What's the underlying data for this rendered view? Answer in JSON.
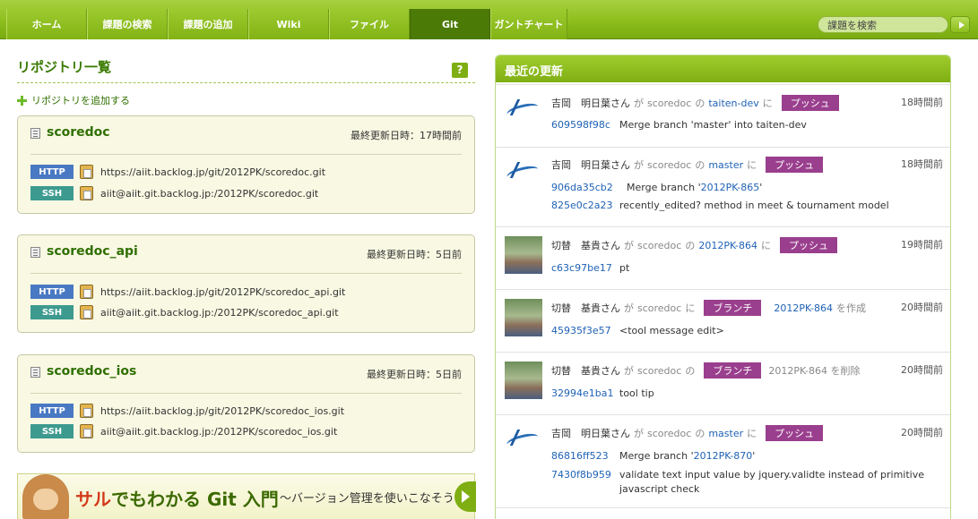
{
  "nav": {
    "tabs": [
      "ホーム",
      "課題の検索",
      "課題の追加",
      "Wiki",
      "ファイル",
      "Git",
      "ガントチャート"
    ],
    "active": "Git",
    "search_placeholder": "課題を検索"
  },
  "repos": {
    "title": "リポジトリ一覧",
    "help": "?",
    "add_label": "リポジトリを追加する",
    "items": [
      {
        "name": "scoredoc",
        "updated": "最終更新日時：17時間前",
        "http_label": "HTTP",
        "http_url": "https://aiit.backlog.jp/git/2012PK/scoredoc.git",
        "ssh_label": "SSH",
        "ssh_url": "aiit@aiit.git.backlog.jp:/2012PK/scoredoc.git"
      },
      {
        "name": "scoredoc_api",
        "updated": "最終更新日時：5日前",
        "http_label": "HTTP",
        "http_url": "https://aiit.backlog.jp/git/2012PK/scoredoc_api.git",
        "ssh_label": "SSH",
        "ssh_url": "aiit@aiit.git.backlog.jp:/2012PK/scoredoc_api.git"
      },
      {
        "name": "scoredoc_ios",
        "updated": "最終更新日時：5日前",
        "http_label": "HTTP",
        "http_url": "https://aiit.backlog.jp/git/2012PK/scoredoc_ios.git",
        "ssh_label": "SSH",
        "ssh_url": "aiit@aiit.git.backlog.jp:/2012PK/scoredoc_ios.git"
      }
    ]
  },
  "banner": {
    "red": "サル",
    "main": "でもわかる Git 入門",
    "sub": "〜バージョン管理を使いこなそう〜"
  },
  "recent": {
    "title": "最近の更新",
    "items": [
      {
        "avatar": "logo",
        "user": "吉岡　明日葉さん",
        "ga": "が",
        "repo": "scoredoc",
        "no": "の",
        "branch": "taiten-dev",
        "ni": "に",
        "badge": "プッシュ",
        "time": "18時間前",
        "commits": [
          {
            "hash": "609598f98c",
            "msg": "Merge branch 'master' into taiten-dev"
          }
        ]
      },
      {
        "avatar": "logo",
        "user": "吉岡　明日葉さん",
        "ga": "が",
        "repo": "scoredoc",
        "no": "の",
        "branch": "master",
        "ni": "に",
        "badge": "プッシュ",
        "time": "18時間前",
        "commits": [
          {
            "hash": "906da35cb2",
            "msg_pre": "Merge branch '",
            "msg_link": "2012PK-865",
            "msg_post": "'"
          },
          {
            "hash": "825e0c2a23",
            "msg": "recently_edited? method in meet & tournament model"
          }
        ]
      },
      {
        "avatar": "photo",
        "user": "切替　基貴さん",
        "ga": "が",
        "repo": "scoredoc",
        "no": "の",
        "branch": "2012PK-864",
        "ni": "に",
        "badge": "プッシュ",
        "time": "19時間前",
        "commits": [
          {
            "hash": "c63c97be17",
            "msg": "pt"
          }
        ]
      },
      {
        "avatar": "photo",
        "user": "切替　基貴さん",
        "ga": "が",
        "repo": "scoredoc",
        "ni": "に",
        "badge": "ブランチ",
        "branch": "2012PK-864",
        "suffix": "を作成",
        "time": "20時間前",
        "commits": [
          {
            "hash": "45935f3e57",
            "msg": "<tool message edit>"
          }
        ]
      },
      {
        "avatar": "photo",
        "user": "切替　基貴さん",
        "ga": "が",
        "repo": "scoredoc",
        "no": "の",
        "badge": "ブランチ",
        "plain": "2012PK-864 を削除",
        "time": "20時間前",
        "commits": [
          {
            "hash": "32994e1ba1",
            "msg": "tool tip"
          }
        ]
      },
      {
        "avatar": "logo",
        "user": "吉岡　明日葉さん",
        "ga": "が",
        "repo": "scoredoc",
        "no": "の",
        "branch": "master",
        "ni": "に",
        "badge": "プッシュ",
        "time": "20時間前",
        "commits": [
          {
            "hash": "86816ff523",
            "msg_pre": "Merge branch '",
            "msg_link": "2012PK-870",
            "msg_post": "'"
          },
          {
            "hash": "7430f8b959",
            "msg": "validate text input value by jquery.validte instead of primitive",
            "msg2": "javascript check"
          }
        ]
      }
    ]
  }
}
